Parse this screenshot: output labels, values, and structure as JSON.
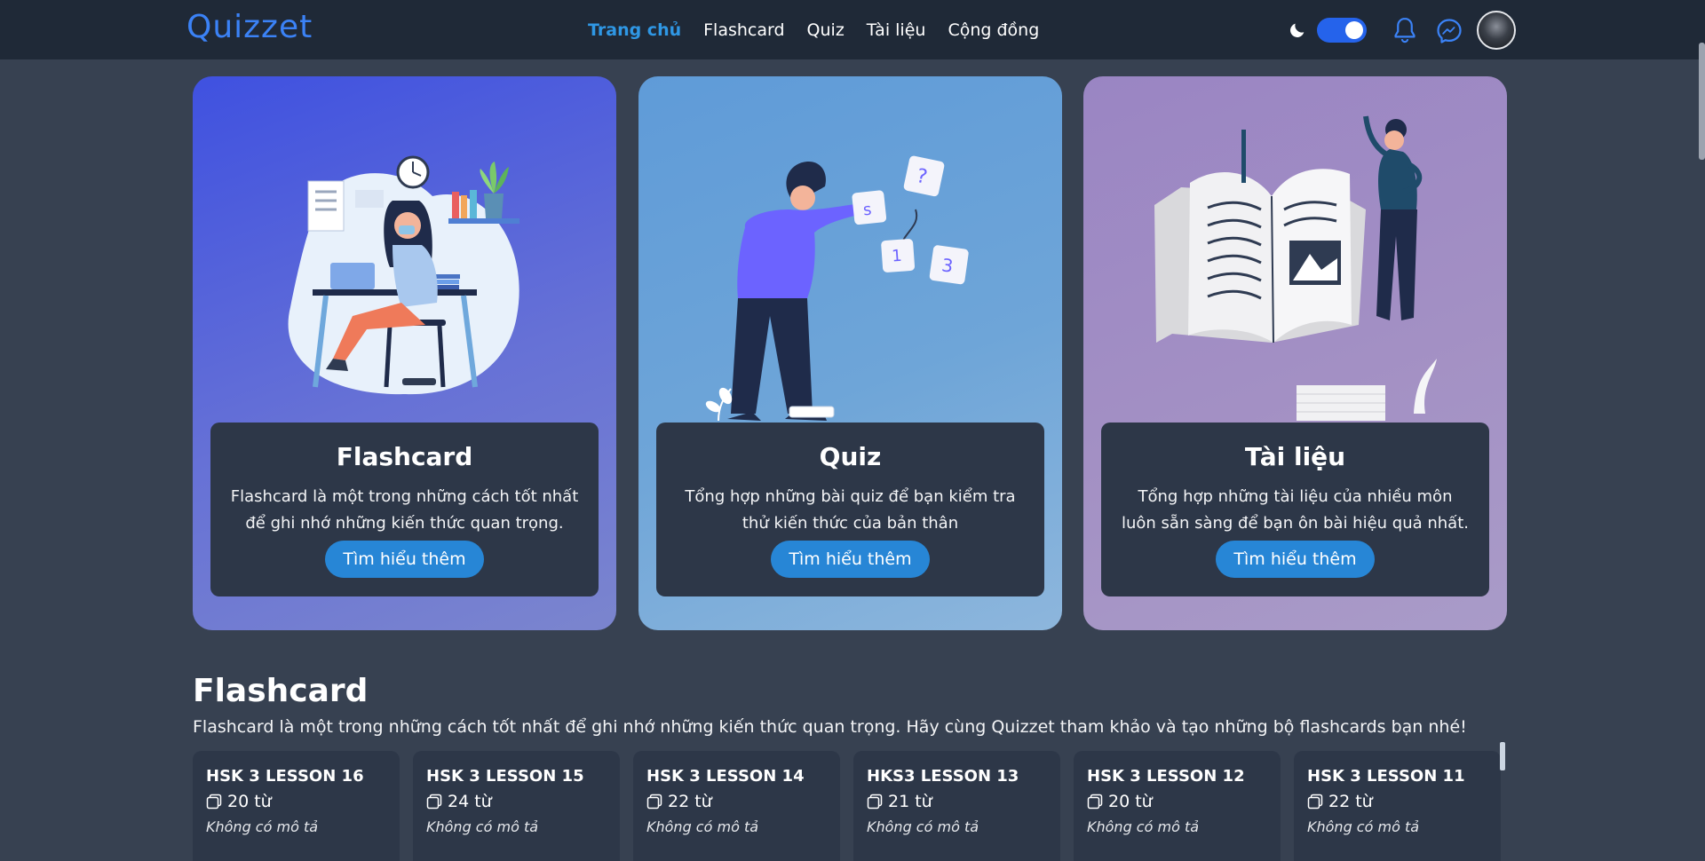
{
  "brand": {
    "logo": "Quizzet",
    "accent": "#3b82f6"
  },
  "nav": {
    "items": [
      {
        "label": "Trang chủ",
        "active": true
      },
      {
        "label": "Flashcard",
        "active": false
      },
      {
        "label": "Quiz",
        "active": false
      },
      {
        "label": "Tài liệu",
        "active": false
      },
      {
        "label": "Cộng đồng",
        "active": false
      }
    ],
    "dark_mode_enabled": true
  },
  "hero": [
    {
      "title": "Flashcard",
      "desc1": "Flashcard là một trong những cách tốt nhất",
      "desc2": "để ghi nhớ những kiến thức quan trọng.",
      "button": "Tìm hiểu thêm"
    },
    {
      "title": "Quiz",
      "desc1": "Tổng hợp những bài quiz để bạn kiểm tra",
      "desc2": "thử kiến thức của bản thân",
      "button": "Tìm hiểu thêm"
    },
    {
      "title": "Tài liệu",
      "desc1": "Tổng hợp những tài liệu của nhiều môn",
      "desc2": "luôn sẵn sàng để bạn ôn bài hiệu quả nhất.",
      "button": "Tìm hiểu thêm"
    }
  ],
  "flashcard_section": {
    "title": "Flashcard",
    "description": "Flashcard là một trong những cách tốt nhất để ghi nhớ những kiến thức quan trọng. Hãy cùng Quizzet tham khảo và tạo những bộ flashcards bạn nhé!",
    "decks": [
      {
        "title": "HSK 3 LESSON 16",
        "count": "20 từ",
        "desc": "Không có mô tả"
      },
      {
        "title": "HSK 3 LESSON 15",
        "count": "24 từ",
        "desc": "Không có mô tả"
      },
      {
        "title": "HSK 3 LESSON 14",
        "count": "22 từ",
        "desc": "Không có mô tả"
      },
      {
        "title": "HKS3 LESSON 13",
        "count": "21 từ",
        "desc": "Không có mô tả"
      },
      {
        "title": "HSK 3 LESSON 12",
        "count": "20 từ",
        "desc": "Không có mô tả"
      },
      {
        "title": "HSK 3 LESSON 11",
        "count": "22 từ",
        "desc": "Không có mô tả"
      }
    ]
  },
  "icons": [
    "moon-icon",
    "notification-bell-icon",
    "messenger-icon",
    "cards-icon"
  ]
}
